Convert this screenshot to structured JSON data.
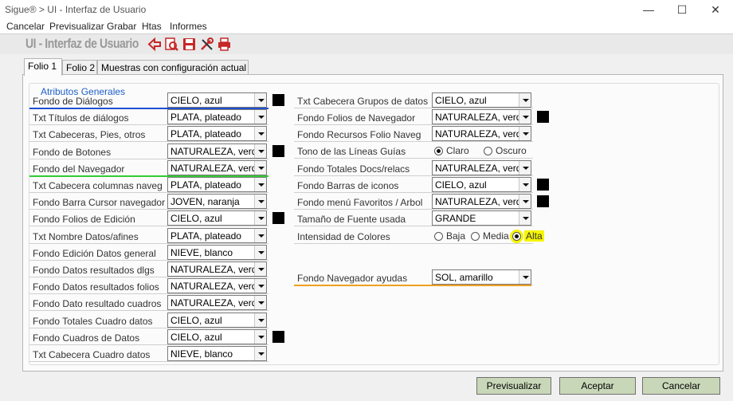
{
  "window": {
    "title": "Sigue® > UI - Interfaz de Usuario",
    "minimize": "—",
    "maximize": "☐",
    "close": "✕"
  },
  "menu": [
    "Cancelar",
    "Previsualizar",
    "Grabar",
    "Htas",
    "Informes"
  ],
  "toolbar": {
    "app_title": "UI - Interfaz de Usuario",
    "icons": [
      "back-icon",
      "preview-icon",
      "save-icon",
      "tools-icon",
      "print-icon"
    ]
  },
  "tabs": [
    "Folio 1",
    "Folio 2",
    "Muestras con configuración actual"
  ],
  "group_title": "Atributos Generales",
  "left_rows": [
    {
      "label": "Fondo de Diálogos",
      "value": "CIELO, azul",
      "swatch": true
    },
    {
      "label": "Txt Títulos de diálogos",
      "value": "PLATA, plateado",
      "swatch": false
    },
    {
      "label": "Txt Cabeceras, Pies, otros",
      "value": "PLATA, plateado",
      "swatch": false
    },
    {
      "label": "Fondo de Botones",
      "value": "NATURALEZA, verd",
      "swatch": true
    },
    {
      "label": "Fondo del Navegador",
      "value": "NATURALEZA, verd",
      "swatch": false
    },
    {
      "label": "Txt Cabecera columnas naveg",
      "value": "PLATA, plateado",
      "swatch": false
    },
    {
      "label": "Fondo Barra Cursor navegador",
      "value": "JOVEN, naranja",
      "swatch": false
    },
    {
      "label": "Fondo Folios de Edición",
      "value": "CIELO, azul",
      "swatch": true
    },
    {
      "label": "Txt Nombre Datos/afines",
      "value": "PLATA, plateado",
      "swatch": false
    },
    {
      "label": "Fondo Edición Datos general",
      "value": "NIEVE, blanco",
      "swatch": false
    },
    {
      "label": "Fondo Datos resultados dlgs",
      "value": "NATURALEZA, verd",
      "swatch": false
    },
    {
      "label": "Fondo Datos resultados folios",
      "value": "NATURALEZA, verd",
      "swatch": false
    },
    {
      "label": "Fondo Dato resultado cuadros",
      "value": "NATURALEZA, verd",
      "swatch": false
    },
    {
      "label": "Fondo Totales Cuadro datos",
      "value": "CIELO, azul",
      "swatch": false
    },
    {
      "label": "Fondo Cuadros de Datos",
      "value": "CIELO, azul",
      "swatch": true
    },
    {
      "label": "Txt Cabecera Cuadro datos",
      "value": "NIEVE, blanco",
      "swatch": false
    }
  ],
  "right_rows": [
    {
      "label": "Txt Cabecera Grupos de datos",
      "value": "CIELO, azul",
      "swatch": false
    },
    {
      "label": "Fondo Folios de Navegador",
      "value": "NATURALEZA, verd",
      "swatch": true
    },
    {
      "label": "Fondo Recursos Folio Naveg",
      "value": "NATURALEZA, verd",
      "swatch": false
    },
    {
      "label": "Tono de las Líneas Guías",
      "radios": [
        "Claro",
        "Oscuro"
      ],
      "selected": 0
    },
    {
      "label": "Fondo Totales Docs/relacs",
      "value": "NATURALEZA, verd",
      "swatch": false
    },
    {
      "label": "Fondo Barras de iconos",
      "value": "CIELO, azul",
      "swatch": true
    },
    {
      "label": "Fondo menú Favoritos / Arbol",
      "value": "NATURALEZA, verd",
      "swatch": true
    },
    {
      "label": "Tamaño de Fuente usada",
      "value": "GRANDE",
      "swatch": false
    },
    {
      "label": "Intensidad de Colores",
      "radios": [
        "Baja",
        "Media",
        "Alta"
      ],
      "selected": 2
    },
    {
      "label": "Fondo Navegador ayudas",
      "value": "SOL, amarillo",
      "swatch": false
    }
  ],
  "buttons": {
    "preview": "Previsualizar",
    "accept": "Aceptar",
    "cancel": "Cancelar"
  },
  "colors": {
    "accent_blue": "#2060c8",
    "button_bg": "#c9d7b9",
    "highlight_blue": "#1f4fd1",
    "highlight_green": "#33cc33",
    "highlight_orange": "#f0a020",
    "highlight_yellow": "#f5f500"
  }
}
